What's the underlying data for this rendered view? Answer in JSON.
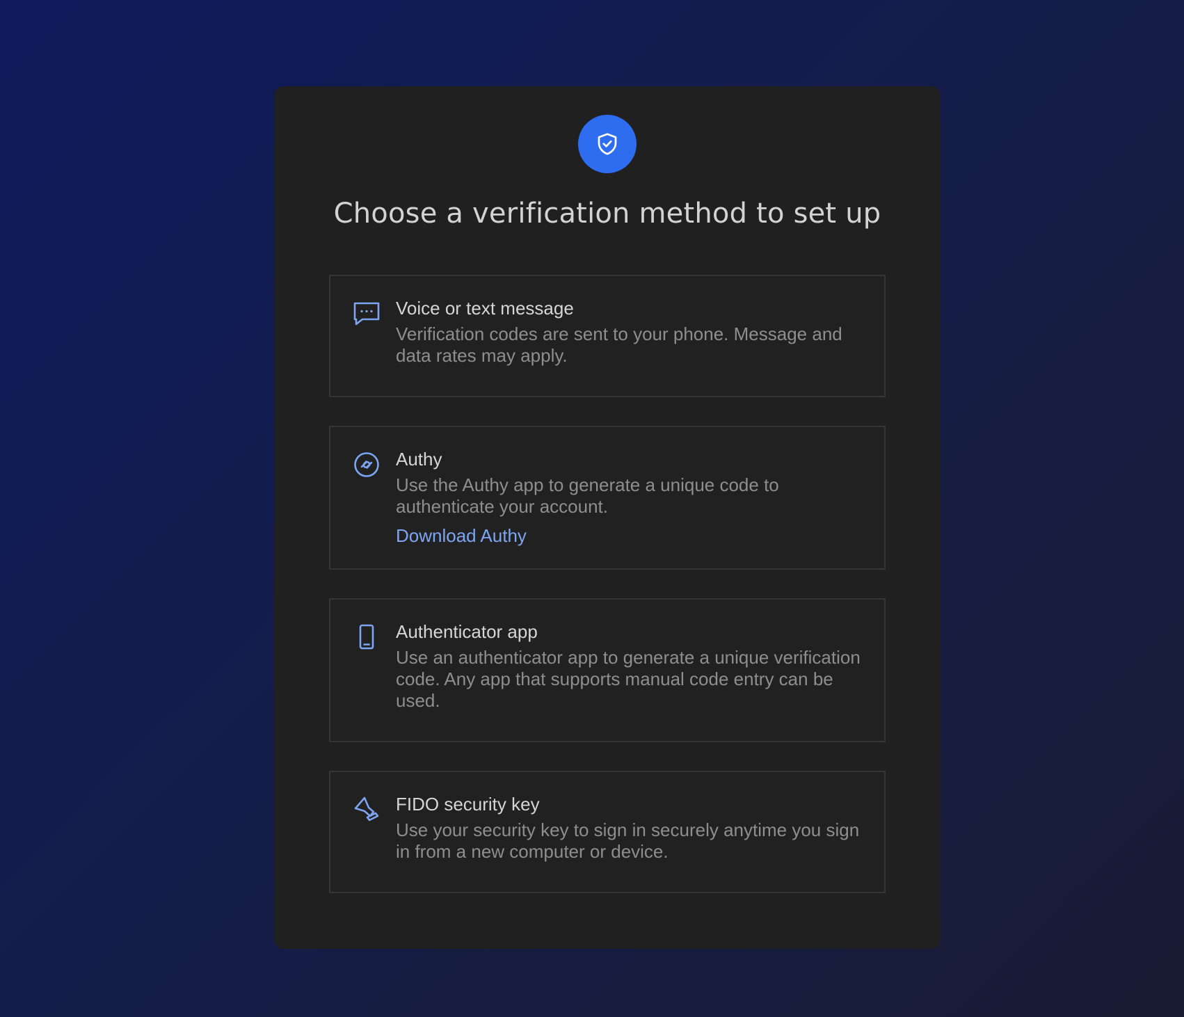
{
  "header": {
    "badge_icon": "shield-check-icon",
    "title": "Choose a verification method to set up"
  },
  "colors": {
    "accent": "#2f6df0",
    "icon": "#7ea5f2",
    "card_bg": "#202020",
    "border": "#353535"
  },
  "options": [
    {
      "icon": "chat-bubble-icon",
      "title": "Voice or text message",
      "description": "Verification codes are sent to your phone. Message and data rates may apply."
    },
    {
      "icon": "authy-icon",
      "title": "Authy",
      "description": "Use the Authy app to generate a unique code to authenticate your account.",
      "link": "Download Authy"
    },
    {
      "icon": "phone-icon",
      "title": "Authenticator app",
      "description": "Use an authenticator app to generate a unique verification code. Any app that supports manual code entry can be used."
    },
    {
      "icon": "security-key-icon",
      "title": "FIDO security key",
      "description": "Use your security key to sign in securely anytime you sign in from a new computer or device."
    }
  ]
}
